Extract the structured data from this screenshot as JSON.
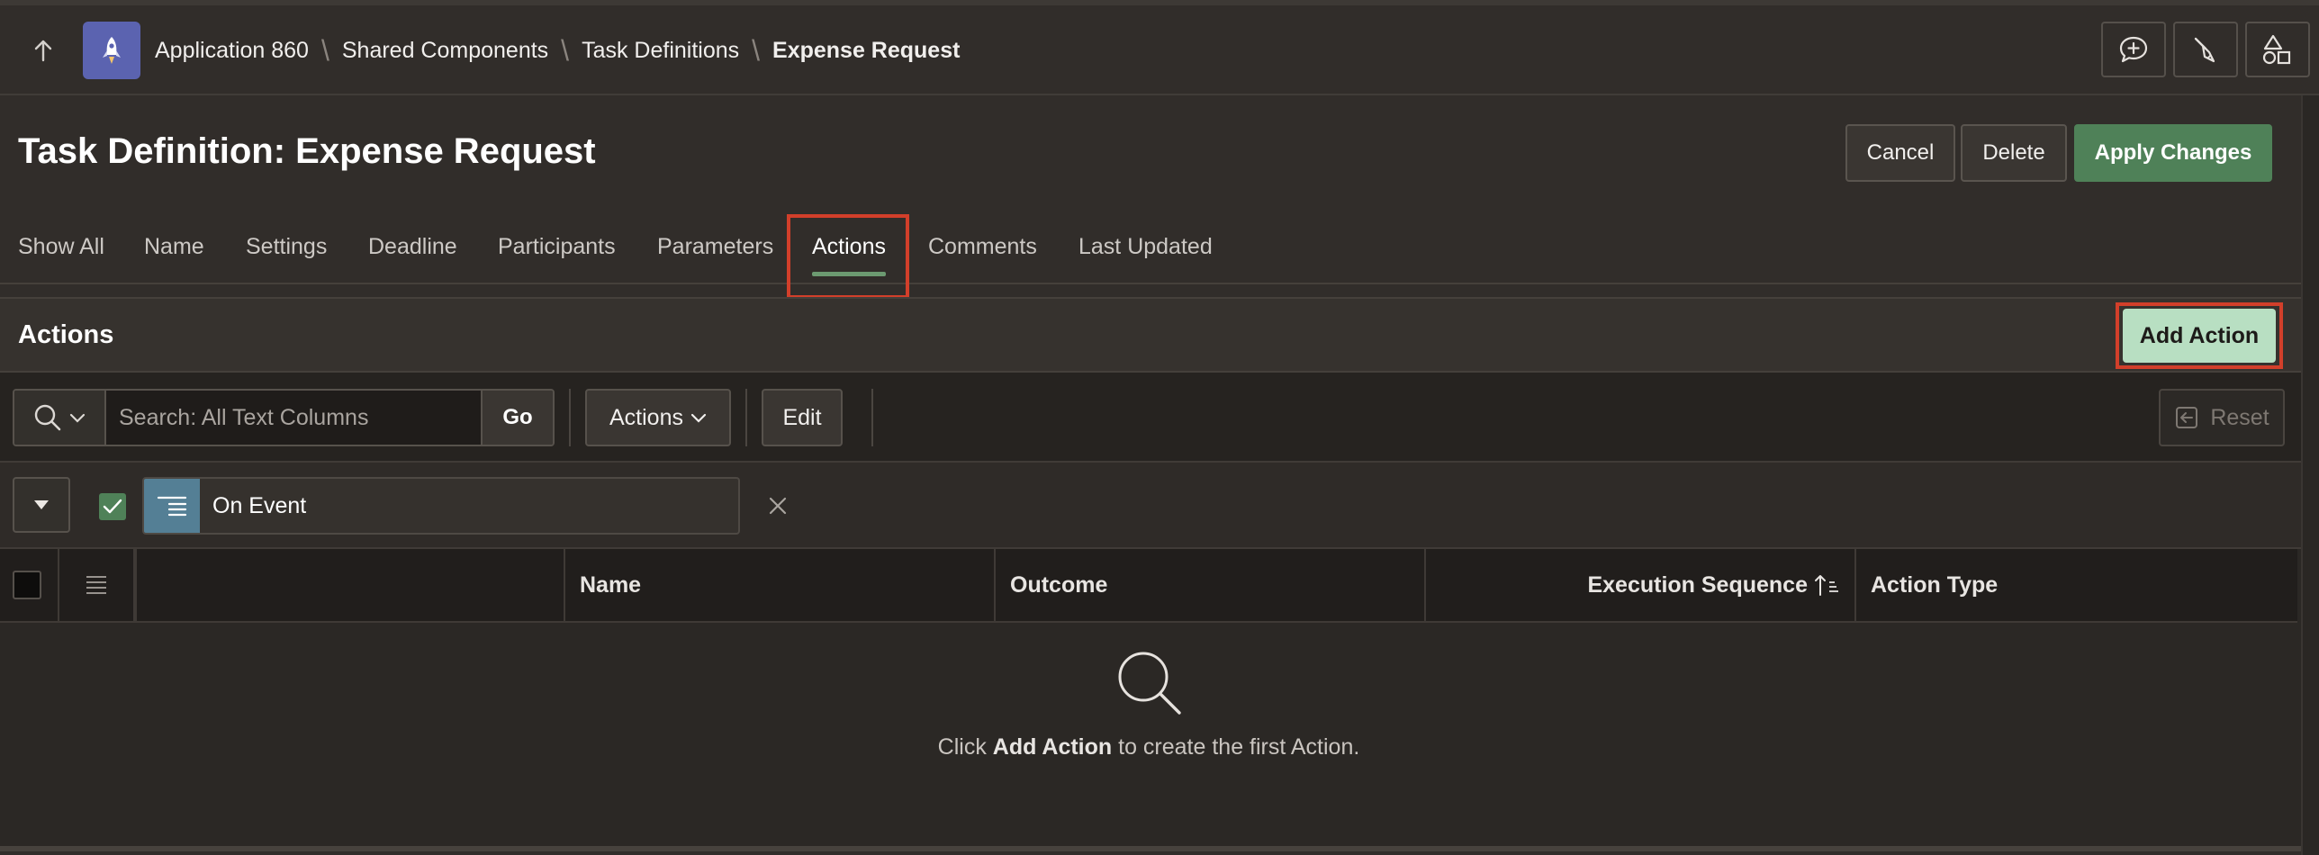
{
  "topbar": {
    "breadcrumbs": [
      "Application 860",
      "Shared Components",
      "Task Definitions",
      "Expense Request"
    ],
    "separator": "\\",
    "tools": [
      "chat-add-icon",
      "broom-icon",
      "shapes-icon"
    ]
  },
  "page": {
    "title": "Task Definition: Expense Request",
    "cancel_label": "Cancel",
    "delete_label": "Delete",
    "apply_label": "Apply Changes"
  },
  "tabs": [
    {
      "label": "Show All"
    },
    {
      "label": "Name"
    },
    {
      "label": "Settings"
    },
    {
      "label": "Deadline"
    },
    {
      "label": "Participants"
    },
    {
      "label": "Parameters"
    },
    {
      "label": "Actions",
      "active": true
    },
    {
      "label": "Comments"
    },
    {
      "label": "Last Updated"
    }
  ],
  "region": {
    "title": "Actions",
    "add_button_label": "Add Action"
  },
  "toolbar": {
    "search_placeholder": "Search: All Text Columns",
    "go_label": "Go",
    "actions_label": "Actions",
    "edit_label": "Edit",
    "reset_label": "Reset"
  },
  "filter": {
    "label": "On Event",
    "enabled": true
  },
  "table": {
    "columns": [
      "",
      "Name",
      "Outcome",
      "Execution Sequence",
      "Action Type"
    ],
    "sort_column": "Execution Sequence",
    "sort_direction": "ascending"
  },
  "empty_state": {
    "prefix": "Click ",
    "emphasis": "Add Action",
    "suffix": " to create the first Action."
  },
  "colors": {
    "accent_green": "#4f8158",
    "highlight_red": "#d23f2a",
    "add_button": "#b8dfc2",
    "app_icon": "#5b63b0"
  }
}
